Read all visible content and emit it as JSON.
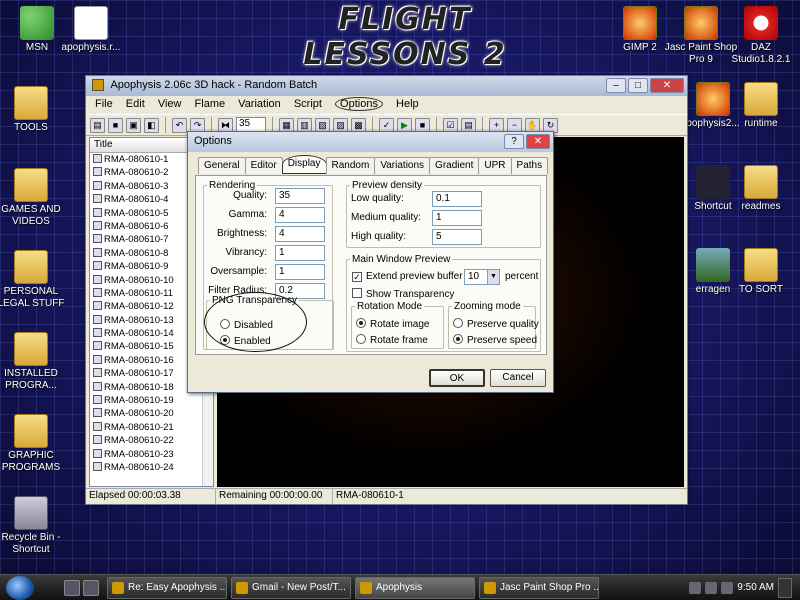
{
  "desktop": {
    "banner": "FLIGHT LESSONS 2",
    "icons": [
      {
        "label": "MSN"
      },
      {
        "label": "apophysis.r..."
      },
      {
        "label": "GIMP 2"
      },
      {
        "label": "Jasc Paint Shop Pro 9"
      },
      {
        "label": "DAZ Studio1.8.2.1"
      },
      {
        "label": "TOOLS"
      },
      {
        "label": "GAMES AND VIDEOS"
      },
      {
        "label": "PERSONAL LEGAL STUFF"
      },
      {
        "label": "INSTALLED PROGRA..."
      },
      {
        "label": "GRAPHIC PROGRAMS"
      },
      {
        "label": "Recycle Bin - Shortcut"
      },
      {
        "label": "pophysis2..."
      },
      {
        "label": "runtime"
      },
      {
        "label": "Shortcut"
      },
      {
        "label": "readmes"
      },
      {
        "label": "erragen"
      },
      {
        "label": "TO SORT"
      }
    ]
  },
  "app": {
    "title": "Apophysis 2.06c 3D hack - Random Batch",
    "menu": [
      "File",
      "Edit",
      "View",
      "Flame",
      "Variation",
      "Script",
      "Options",
      "Help"
    ],
    "toolbar_select": "35",
    "list_header": "Title",
    "list_items": [
      "RMA-080610-1",
      "RMA-080610-2",
      "RMA-080610-3",
      "RMA-080610-4",
      "RMA-080610-5",
      "RMA-080610-6",
      "RMA-080610-7",
      "RMA-080610-8",
      "RMA-080610-9",
      "RMA-080610-10",
      "RMA-080610-11",
      "RMA-080610-12",
      "RMA-080610-13",
      "RMA-080610-14",
      "RMA-080610-15",
      "RMA-080610-16",
      "RMA-080610-17",
      "RMA-080610-18",
      "RMA-080610-19",
      "RMA-080610-20",
      "RMA-080610-21",
      "RMA-080610-22",
      "RMA-080610-23",
      "RMA-080610-24"
    ],
    "status": {
      "elapsed": "Elapsed 00:00:03.38",
      "remaining": "Remaining 00:00:00.00",
      "current": "RMA-080610-1"
    }
  },
  "dialog": {
    "title": "Options",
    "help_btn": "?",
    "tabs": [
      "General",
      "Editor",
      "Display",
      "Random",
      "Variations",
      "Gradient",
      "UPR",
      "Paths"
    ],
    "rendering": {
      "legend": "Rendering",
      "fields": [
        {
          "label": "Quality:",
          "value": "35"
        },
        {
          "label": "Gamma:",
          "value": "4"
        },
        {
          "label": "Brightness:",
          "value": "4"
        },
        {
          "label": "Vibrancy:",
          "value": "1"
        },
        {
          "label": "Oversample:",
          "value": "1"
        },
        {
          "label": "Filter Radius:",
          "value": "0.2"
        }
      ]
    },
    "png": {
      "legend": "PNG Transparency",
      "disabled": "Disabled",
      "enabled": "Enabled"
    },
    "preview_density": {
      "legend": "Preview density",
      "fields": [
        {
          "label": "Low quality:",
          "value": "0.1"
        },
        {
          "label": "Medium quality:",
          "value": "1"
        },
        {
          "label": "High quality:",
          "value": "5"
        }
      ]
    },
    "main_preview": {
      "legend": "Main Window Preview",
      "extend_label": "Extend preview buffer by",
      "extend_value": "10",
      "extend_unit": "percent",
      "show_transparency": "Show Transparency"
    },
    "rotation": {
      "legend": "Rotation Mode",
      "rotate_image": "Rotate image",
      "rotate_frame": "Rotate frame"
    },
    "zooming": {
      "legend": "Zooming mode",
      "preserve_quality": "Preserve quality",
      "preserve_speed": "Preserve speed"
    },
    "ok": "OK",
    "cancel": "Cancel"
  },
  "taskbar": {
    "tasks": [
      "Re: Easy Apophysis ...",
      "Gmail - New Post/T...",
      "Apophysis",
      "Jasc Paint Shop Pro ..."
    ],
    "clock": "9:50 AM"
  }
}
